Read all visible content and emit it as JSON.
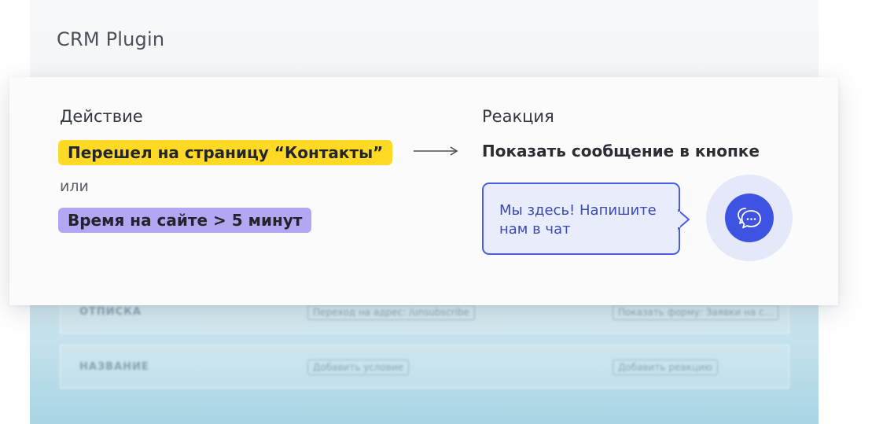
{
  "app": {
    "title": "CRM Plugin"
  },
  "background_rows": [
    {
      "name": "ОТПИСКА",
      "condition": "Переход на адрес: /unsubscribe",
      "reaction": "Показать форму: Заявки на с..."
    },
    {
      "name": "НАЗВАНИЕ",
      "condition": "Добавить условие",
      "reaction": "Добавить реакцию"
    }
  ],
  "card": {
    "action_label": "Действие",
    "reaction_label": "Реакция",
    "condition_1": "Перешел на страницу “Контакты”",
    "or_text": "или",
    "condition_2": "Время на сайте > 5 минут",
    "reaction_text": "Показать сообщение в кнопке",
    "bubble_message": "Мы здесь! Напишите нам в чат"
  },
  "colors": {
    "accent": "#3f53e3",
    "yellow_tag": "#ffd924",
    "purple_tag": "#b3a6f2",
    "bubble_bg": "#e9edfb"
  },
  "icons": {
    "arrow": "arrow-right-icon",
    "chat": "chat-bubbles-icon"
  }
}
